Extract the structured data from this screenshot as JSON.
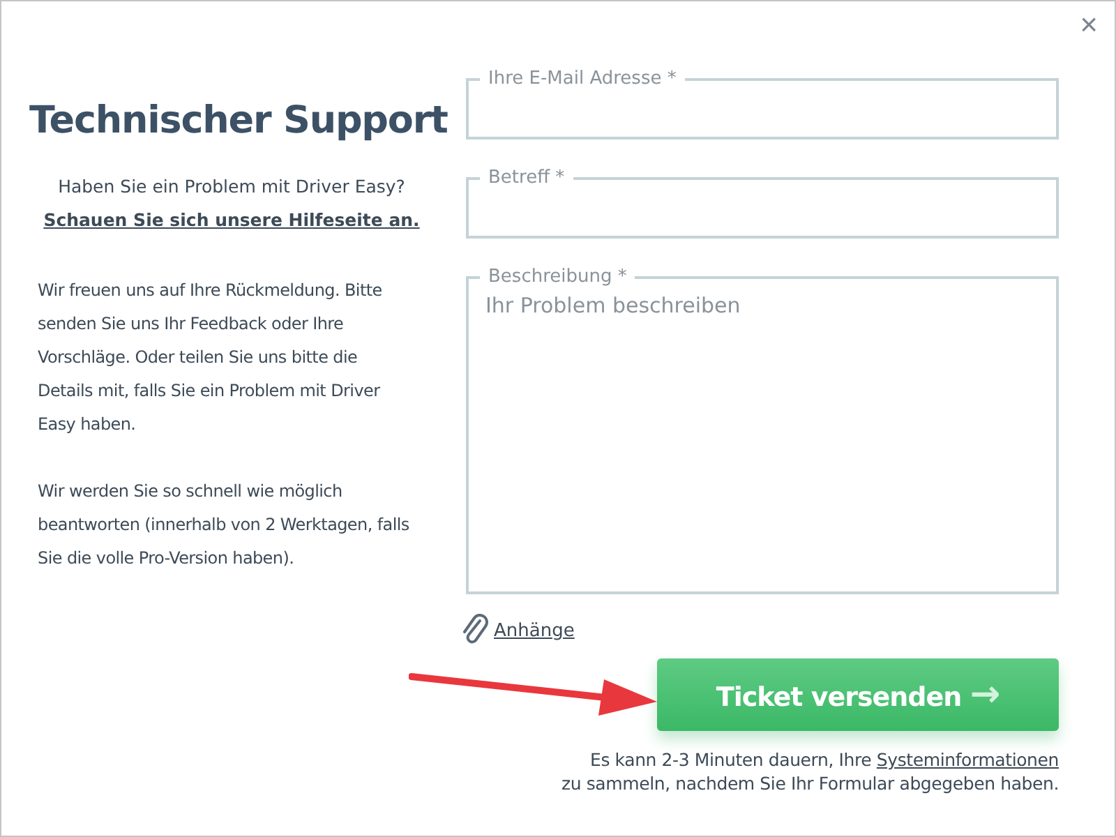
{
  "window": {
    "close": "×"
  },
  "title": "Technischer Support",
  "intro": {
    "question": "Haben Sie ein Problem mit Driver Easy?",
    "link": "Schauen Sie sich unsere Hilfeseite an."
  },
  "paragraphs": [
    "Wir freuen uns auf Ihre Rückmeldung. Bitte senden Sie uns Ihr Feedback oder Ihre Vorschläge. Oder teilen Sie uns bitte die Details mit, falls Sie ein Problem mit Driver Easy haben.",
    "Wir werden Sie so schnell wie möglich beantworten (innerhalb von 2 Werktagen, falls Sie die volle Pro-Version haben)."
  ],
  "fields": [
    {
      "kind": "line",
      "label": "Ihre E-Mail Adresse *"
    },
    {
      "kind": "line",
      "label": "Betreff *"
    },
    {
      "kind": "area",
      "label": "Beschreibung *",
      "placeholder": "Ihr Problem beschreiben"
    }
  ],
  "attachments": "Anhänge",
  "submit": {
    "label": "Ticket versenden",
    "arrow": "→"
  },
  "note": {
    "before": "Es kann 2-3 Minuten dauern, Ihre ",
    "link": "Systeminformationen",
    "after": "zu sammeln, nachdem Sie Ihr Formular abgegeben haben."
  }
}
